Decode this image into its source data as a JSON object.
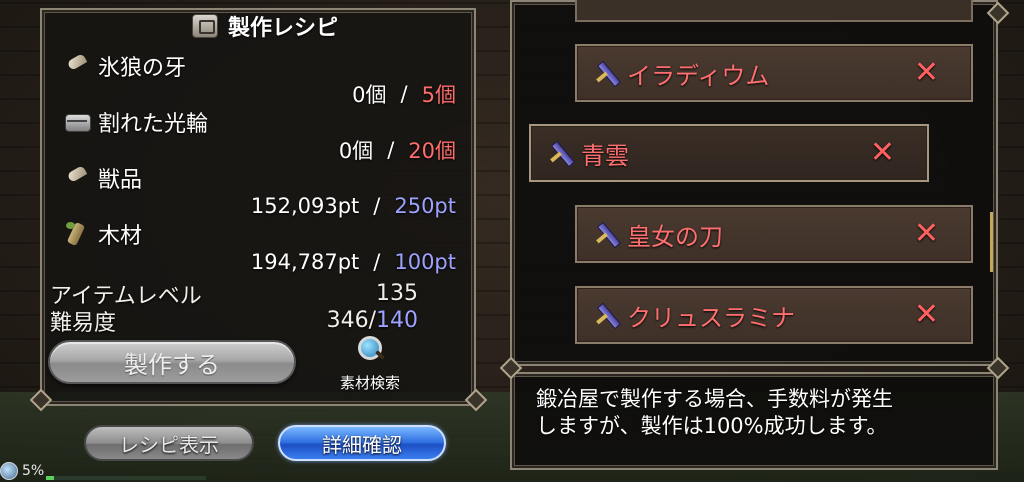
{
  "crafting": {
    "title": "製作レシピ",
    "materials": [
      {
        "icon": "fang-icon",
        "name": "氷狼の牙",
        "have": "0個",
        "need": "5個",
        "need_color": "red"
      },
      {
        "icon": "chest-icon",
        "name": "割れた光輪",
        "have": "0個",
        "need": "20個",
        "need_color": "red"
      },
      {
        "icon": "fang-icon",
        "name": "獣品",
        "have": "152,093pt",
        "need": "250pt",
        "need_color": "blue"
      },
      {
        "icon": "wood-icon",
        "name": "木材",
        "have": "194,787pt",
        "need": "100pt",
        "need_color": "blue"
      }
    ],
    "separator": "/",
    "item_level_label": "アイテムレベル",
    "item_level_value": "135",
    "difficulty_label": "難易度",
    "difficulty_have": "346/",
    "difficulty_need": "140",
    "craft_button": "製作する",
    "search_label": "素材検索"
  },
  "bottom_buttons": {
    "recipe": "レシピ表示",
    "detail": "詳細確認"
  },
  "hud": {
    "percent_label": "5%",
    "percent_value": 5
  },
  "recipes": [
    {
      "name": "イラディウム",
      "status": "✕",
      "selected": false
    },
    {
      "name": "青雲",
      "status": "✕",
      "selected": true
    },
    {
      "name": "皇女の刀",
      "status": "✕",
      "selected": false
    },
    {
      "name": "クリュスラミナ",
      "status": "✕",
      "selected": false
    }
  ],
  "info": {
    "line1": "鍛冶屋で製作する場合、手数料が発生",
    "line2": "しますが、製作は100%成功します。"
  },
  "colors": {
    "need_red": "#ff6d6d",
    "need_blue": "#9ea2ff",
    "recipe_text": "#ff6f6f",
    "detail_button": "#2f6fe0"
  }
}
